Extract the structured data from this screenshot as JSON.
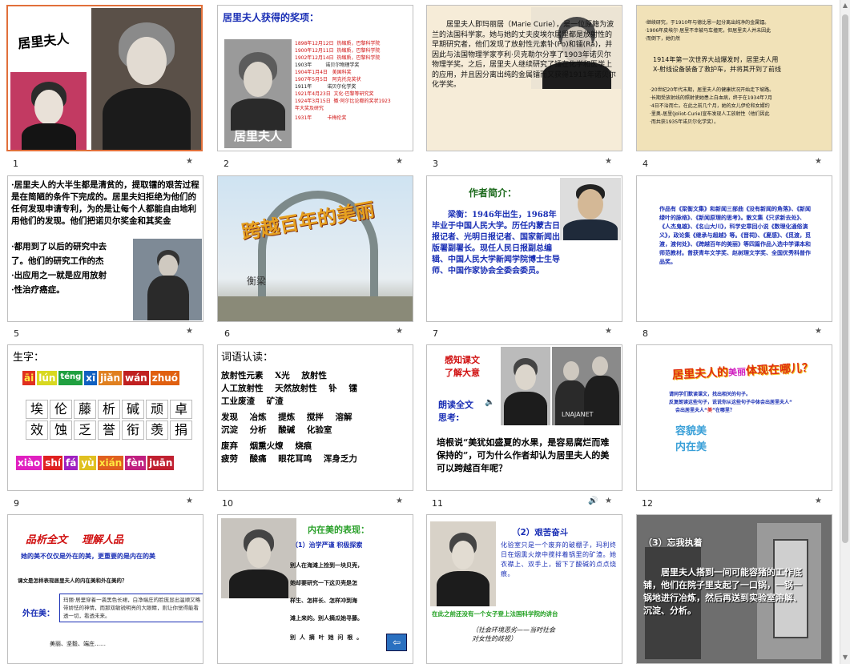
{
  "colors": {
    "accent_selected": "#e1703a",
    "slide_border": "#bfbfbf"
  },
  "slides": [
    {
      "number": "1",
      "title": "居里夫人"
    },
    {
      "number": "2",
      "title": "居里夫人获得的奖项：",
      "book_title": "居里夫人",
      "awards": [
        "1898年12月12日  热缩质，巴黎科学院",
        "1900年12月11日  热缩质，巴黎科学院",
        "1902年12月14日  热缩质，巴黎科学院",
        "1903年         诺贝尔物理学奖",
        "1904年1月4日   美国科奖",
        "1907年5月5日   阿克托克奖状",
        "1911年          诺贝尔化学奖",
        "1921年4月23日  文化·巴黎等研究奖",
        "1924年3月15日  徽·阿尔比论都的奖状1923",
        "年大奖及研究",
        "1931年          卡梅伦奖"
      ]
    },
    {
      "number": "3",
      "text": "居里夫人即玛丽居（Marie Curie），是一位原籍为波兰的法国科学家。她与她的丈夫皮埃尔居里都是放射性的早期研究者，他们发现了放射性元素钋(Po)和镭(Ra)，并因此与法国物理学家亨利·贝克勒尔分享了1903年诺贝尔物理学奖。之后，居里夫人继续研究了镭在化学和医学上的应用，并且因分离出纯的金属镭而又获得1911年诺贝尔化学奖。"
    },
    {
      "number": "4",
      "lines": [
        "·继续研究，于1910年与德比恩一起分离出纯净的金属镭。",
        "·1906年皮埃尔·居里不幸被马车撞死，但居里夫人并未因此",
        "·而倒下，她仍然",
        "1914年第一次世界大战爆发时，居里夫人用",
        "X-射线设备装备了救护车，并将其开到了前线",
        "·20世纪20年代末期，居里夫人的健康状况开始走下坡路。",
        "·长期受放射线的照射使她患上白血病，终于在1934年7月",
        "·4日不治而亡。在此之前几个月，她的女儿伊伦和女婿约",
        "·里奥-居里(Joliot-Curie)宣布发现人工放射性（他们因此",
        "·而共获1935年诺贝尔化学奖）。"
      ]
    },
    {
      "number": "5",
      "text": "·居里夫人的大半生都是清贫的，提取镭的艰苦过程是在简陋的条件下完成的。居里夫妇拒绝为他们的任何发现申请专利，为的是让每个人都能自由地利用他们的发现。他们把诺贝尔奖金和其奖金",
      "lines_short": [
        "·都用到了以后的研究中去",
        "了。他们的研究工作的杰",
        "·出应用之一就是应用放射",
        "·性治疗癌症。"
      ]
    },
    {
      "number": "6",
      "title": "跨越百年的美丽",
      "author": "衡梁"
    },
    {
      "number": "7",
      "heading": "作者简介：",
      "text": "梁衡：1946年出生，1968年毕业于中国人民大学。历任内蒙古日报记者、光明日报记者、国家新闻出版署副署长。现任人民日报副总编辑、中国人民大学新闻学院博士生导师、中国作家协会全委会委员。"
    },
    {
      "number": "8",
      "text": "作品有《梁衡文集》和新闻三部曲《没有新闻的角落》、《新闻绿叶的脉络》、《新闻原理的思考》。散文集《只求新去处》、《人杰鬼雄》、《名山大川》，科学史章回小说《数理化通俗演义》，政论集《继承与超越》等。《晋祠》、《夏感》、《觅渡，觅渡，渡何处》、《跨越百年的美丽》等四篇作品入选中学课本和师范教材。曾获青年文学奖、赵树理文学奖、全国优秀科普作品奖。"
    },
    {
      "number": "9",
      "title": "生字：",
      "pinyin_top": [
        "āi",
        "lún",
        "téng",
        "xī",
        "jiǎn",
        "wán",
        "zhuó"
      ],
      "chars_row1": [
        "埃",
        "伦",
        "藤",
        "析",
        "碱",
        "顽",
        "卓"
      ],
      "chars_row2": [
        "效",
        "蚀",
        "乏",
        "誉",
        "衔",
        "羡",
        "捐"
      ],
      "pinyin_bottom": [
        "xiào",
        "shí",
        "fá",
        "yù",
        "xián",
        "fèn",
        "juān"
      ]
    },
    {
      "number": "10",
      "title": "词语认读：",
      "lines": [
        "放射性元素    X光    放射性",
        "人工放射性    天然放射性    钋    镭",
        "工业废渣    矿渣",
        "发现    冶炼    提炼    搅拌    溶解",
        "沉淀    分析    酸碱    化验室",
        "废弃    烟熏火燎    烧痕",
        "疲劳    酸痛    眼花耳鸣    浑身乏力"
      ]
    },
    {
      "number": "11",
      "line1": "感知课文",
      "line2": "了解大意",
      "line3": "朗读全文",
      "line4": "思考:",
      "watermark": "LNAJANET",
      "question": "培根说“美犹如盛夏的水果，是容易腐烂而难保持的”，可为什么作者却认为居里夫人的美可以跨越百年呢？"
    },
    {
      "number": "12",
      "title_part1": "居里夫人的",
      "title_part2": "美丽",
      "title_part3": "体现在哪儿？",
      "bullets": [
        "请同学们默读课文，找出相关的句子。",
        "反复朗读这些句子，说说你从这些句子中体会出居里夫人“",
        "美",
        "”在哪里？"
      ],
      "labels": [
        "容貌美",
        "内在美"
      ]
    },
    {
      "number": "",
      "title": "品析全文    理解人品",
      "sub": "她的美不仅仅是外在的美，更重要的是内在的美",
      "question": "课文是怎样表现居里夫人的内在美和外在美的？",
      "label": "外在美：",
      "quote": "玛丽·居里穿着一袭黑色长裙，白净端庄的脸庞显出温顺又略带娇怯的神情，而那双敏锐明亮的大眼睛，则让你觉得能看透一切，看透未来。",
      "footer": "美丽、坚毅、端庄……"
    },
    {
      "number": "",
      "title": "内在美的表现：",
      "point": "（1）治学严谨  积极探索",
      "lines": [
        "别人在海滩上捡到一块贝壳，",
        "她却要研究一下这贝壳是怎",
        "样生、怎样长、怎样冲到海",
        "滩上来的。别人摘瓜她寻藤。",
        "别  人  摘  叶  她  问  根  。"
      ]
    },
    {
      "number": "",
      "title": "（2）艰苦奋斗",
      "text": "化验室只是一个废弃的破棚子，玛利终日在烟熏火燎中搅拌着锅里的矿渣。她衣襟上、双手上，留下了酸碱的点点烧痕。",
      "green": "在此之前还没有一个女子登上法国科学院的讲台",
      "note": "（社会环境恶劣——当时社会对女性的歧视）"
    },
    {
      "number": "",
      "title": "（3）忘我执着",
      "text": "居里夫人搭到一间可能容猪的工作底铺，他们在院子里支起了一口锅，一锅一锅地进行冶炼，然后再送到实验室溶解、沉淀、分析。"
    }
  ]
}
